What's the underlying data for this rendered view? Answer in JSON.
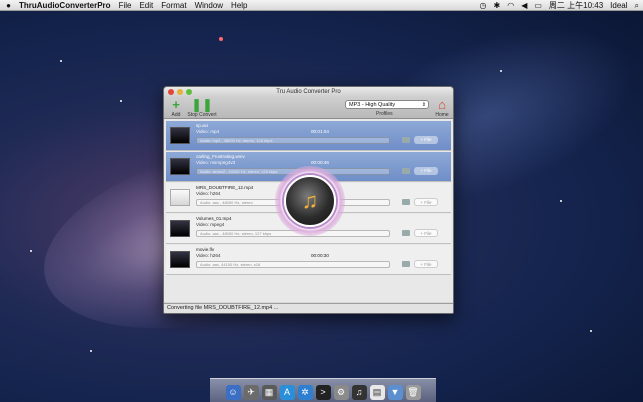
{
  "menubar": {
    "app_name": "ThruAudioConverterPro",
    "menus": [
      "File",
      "Edit",
      "Format",
      "Window",
      "Help"
    ],
    "clock": "周二 上午10:43",
    "user": "Ideal"
  },
  "window": {
    "title": "Tru Audio Converter Pro"
  },
  "toolbar": {
    "add_label": "Add",
    "stop_label": "Stop Convert",
    "profile_value": "MP3 - High Quality",
    "profiles_label": "Profiles",
    "home_label": "Home"
  },
  "rows": [
    {
      "filename": "sp.avi",
      "video": "Video: mp4",
      "duration": "00:01:04",
      "audio": "Audio: mp3 , 48000 Hz, stereo, 128 kbps",
      "button": "+ File"
    },
    {
      "filename": "carling_Frustrating.wmv",
      "video": "Video: msmpeg4v3",
      "duration": "00:00:46",
      "audio": "Audio: wmav2 , 44100 Hz, stereo, 128 kbps",
      "button": "+ File"
    },
    {
      "filename": "MRS_DOUBTFIRE_12.mp4",
      "video": "Video: h264",
      "duration": "00:00:30",
      "audio": "Audio: aac , 48000 Hz, stereo",
      "button": "+ File"
    },
    {
      "filename": "Volumes_01.mp4",
      "video": "Video: mpeg4",
      "duration": "",
      "audio": "Audio: aac , 48000 Hz, stereo, 127 kbps",
      "button": "+ File"
    },
    {
      "filename": "movie.flv",
      "video": "Video: h264",
      "duration": "00:00:30",
      "audio": "Audio: aac, 44100 Hz, stereo, s16",
      "button": "+ File"
    }
  ],
  "status": {
    "text": "Converting file MRS_DOUBTFIRE_12.mp4 ..."
  },
  "icons": {
    "overlay": "music-note-disc-icon",
    "accent": "#f2b23a"
  }
}
